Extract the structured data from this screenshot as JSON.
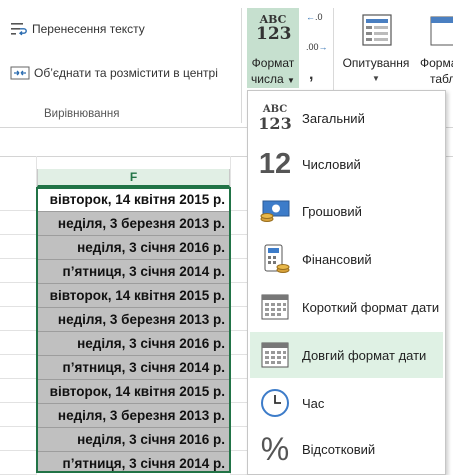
{
  "ribbon": {
    "wrap_text": "Перенесення тексту",
    "merge_center": "Об’єднати та розмістити в центрі",
    "alignment_group": "Вирівнювання",
    "number_format_btn": {
      "abc": "ABC",
      "num": "123",
      "line1": "Формат",
      "line2": "числа"
    },
    "comma_label": ",",
    "increase_decimal": ".00",
    "decrease_decimal": ".0",
    "survey_label": "Опитування",
    "format_table_line1": "Форма",
    "format_table_line2": "табл"
  },
  "sheet": {
    "column_header": "F",
    "cells": [
      "вівторок, 14 квітня 2015 р.",
      "неділя, 3 березня 2013 р.",
      "неділя, 3 січня 2016 р.",
      "п’ятниця, 3 січня 2014 р.",
      "вівторок, 14 квітня 2015 р.",
      "неділя, 3 березня 2013 р.",
      "неділя, 3 січня 2016 р.",
      "п’ятниця, 3 січня 2014 р.",
      "вівторок, 14 квітня 2015 р.",
      "неділя, 3 березня 2013 р.",
      "неділя, 3 січня 2016 р.",
      "п’ятниця, 3 січня 2014 р."
    ]
  },
  "dropdown": {
    "items": [
      {
        "label": "Загальний",
        "icon": "general-format-icon",
        "abc": "ABC",
        "num": "123"
      },
      {
        "label": "Числовий",
        "icon": "number-format-icon",
        "big": "12"
      },
      {
        "label": "Грошовий",
        "icon": "currency-format-icon"
      },
      {
        "label": "Фінансовий",
        "icon": "accounting-format-icon"
      },
      {
        "label": "Короткий формат дати",
        "icon": "short-date-icon"
      },
      {
        "label": "Довгий формат дати",
        "icon": "long-date-icon"
      },
      {
        "label": "Час",
        "icon": "clock-icon"
      },
      {
        "label": "Відсотковий",
        "icon": "percent-icon",
        "big": "%"
      }
    ],
    "highlighted_index": 5
  },
  "colors": {
    "accent": "#217346",
    "highlight": "#dff1e4",
    "selection_fill": "#c0c0c0"
  }
}
